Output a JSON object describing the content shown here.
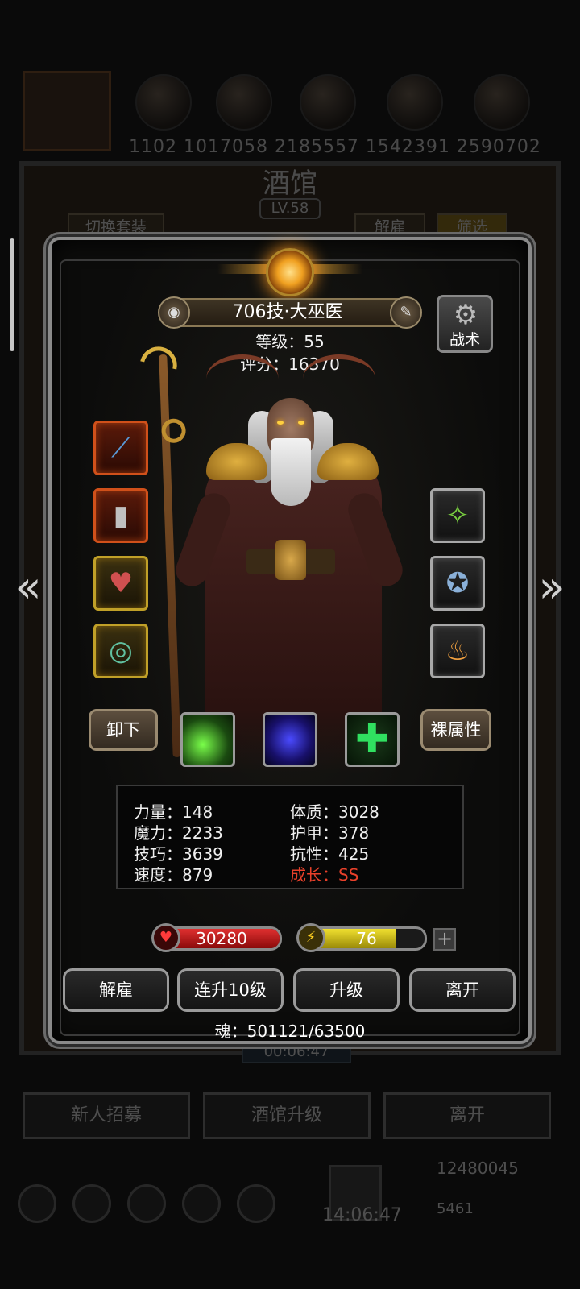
{
  "background": {
    "resource_numbers": "1102",
    "resource_line": "1102   1017058  2185557  1542391  2590702",
    "tavern_title": "酒馆",
    "tavern_level": "LV.58",
    "switch_set": "切换套装",
    "dismiss": "解雇",
    "filter": "筛选",
    "timer": "00:06:47",
    "recruit": "新人招募",
    "tavern_upgrade": "酒馆升级",
    "leave": "离开",
    "coins": "12480045",
    "clock": "14:06:47",
    "gems": "5461"
  },
  "hero": {
    "name": "706技·大巫医",
    "level_label": "等级：55",
    "score_label": "评分：16370",
    "tactic_label": "战术"
  },
  "equipment": {
    "left": [
      {
        "name": "staff",
        "icon": "✦",
        "rarity": "red"
      },
      {
        "name": "robe",
        "icon": "▮",
        "rarity": "red"
      },
      {
        "name": "heart-amulet",
        "icon": "♥",
        "rarity": "gold"
      },
      {
        "name": "orb-chain",
        "icon": "◎",
        "rarity": "gold"
      }
    ],
    "right": [
      {
        "name": "green-charm",
        "icon": "✧",
        "rarity": "silver"
      },
      {
        "name": "crest",
        "icon": "✪",
        "rarity": "silver"
      },
      {
        "name": "lantern",
        "icon": "♨",
        "rarity": "silver"
      }
    ]
  },
  "buttons": {
    "unequip": "卸下",
    "base_attributes": "裸属性",
    "dismiss": "解雇",
    "level_up_10": "连升10级",
    "level_up": "升级",
    "leave": "离开"
  },
  "stats": {
    "strength": "力量：148",
    "magic": "魔力：2233",
    "skill": "技巧：3639",
    "speed": "速度：879",
    "constitution": "体质：3028",
    "armor": "护甲：378",
    "resistance": "抗性：425",
    "growth": "成长：SS"
  },
  "bars": {
    "hp": "30280",
    "energy": "76",
    "energy_fill": 0.76
  },
  "soul": "魂：501121/63500",
  "colors": {
    "hp": "#c21818",
    "energy": "#d8c818",
    "growth": "#e8402a"
  }
}
